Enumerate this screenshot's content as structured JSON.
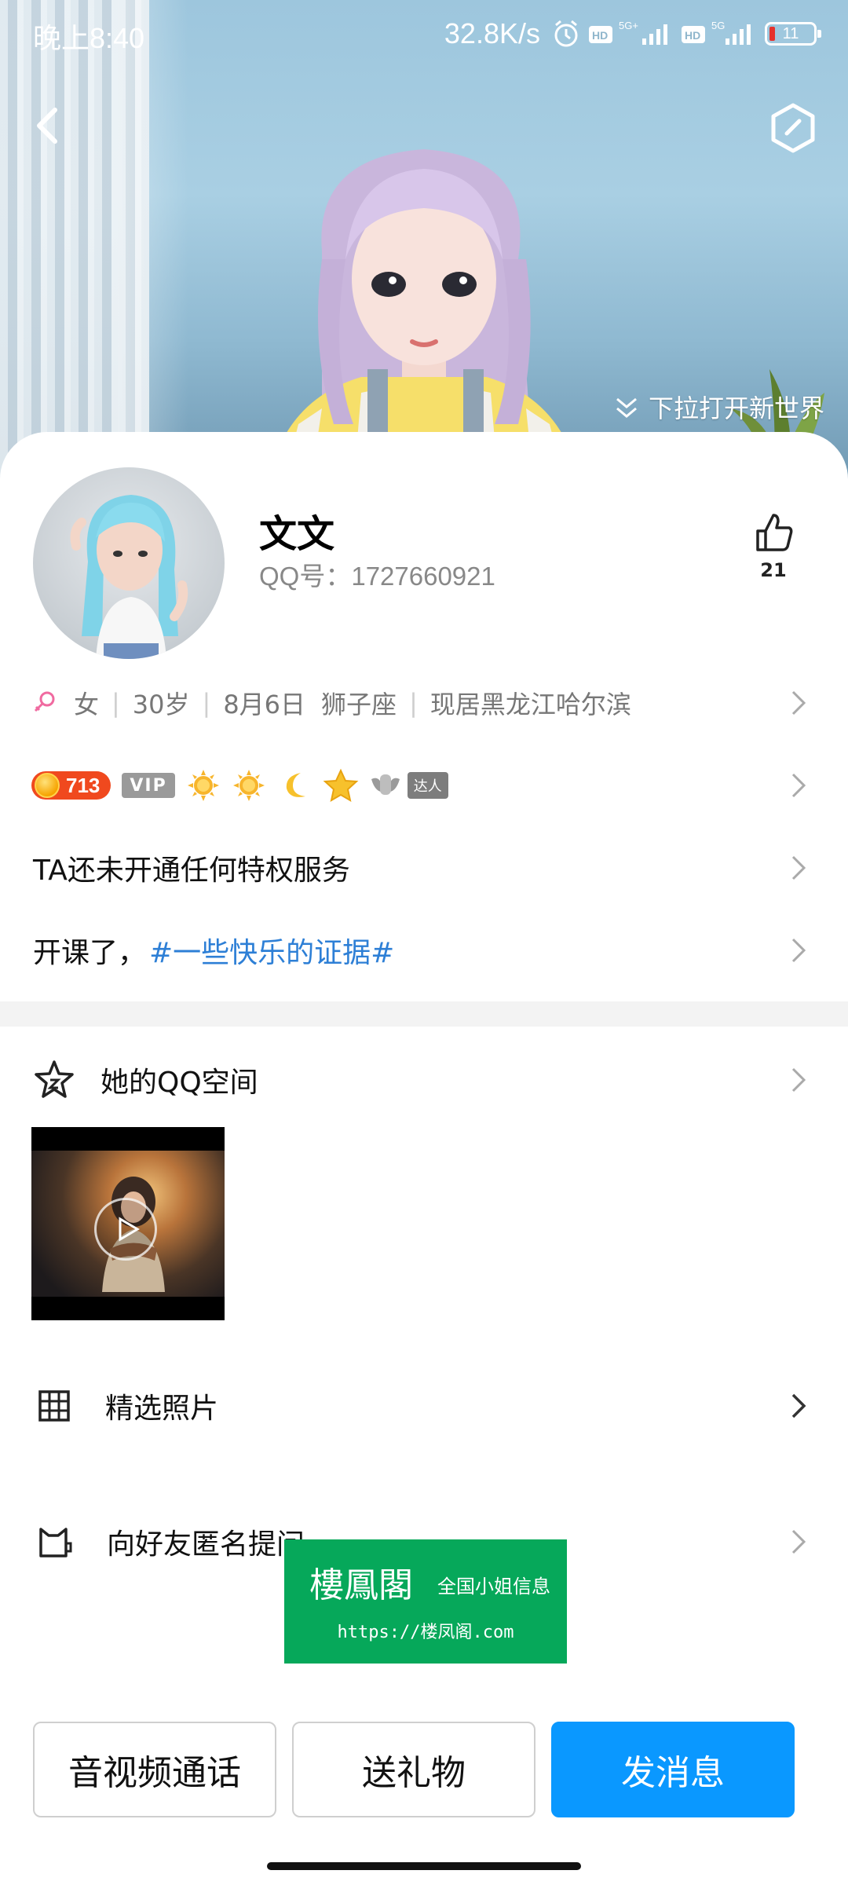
{
  "status_bar": {
    "time": "晚上8:40",
    "net_speed": "32.8K/s",
    "battery": "11"
  },
  "cover": {
    "pull_hint": "下拉打开新世界"
  },
  "profile": {
    "name": "文文",
    "qq_label": "QQ号：1727660921",
    "likes": "21",
    "gender": "女",
    "age": "30岁",
    "birthday": "8月6日",
    "zodiac": "狮子座",
    "location": "现居黑龙江哈尔滨"
  },
  "badges": {
    "level": "713",
    "vip": "VIP",
    "daren": "达人"
  },
  "privilege_text": "TA还未开通任何特权服务",
  "signature": {
    "text": "开课了，",
    "tag": "#一些快乐的证据#"
  },
  "qzone": {
    "title": "她的QQ空间"
  },
  "photos": {
    "title": "精选照片"
  },
  "anon_ask": {
    "title": "向好友匿名提问"
  },
  "watermark": {
    "title": "樓鳳閣",
    "subtitle": "全国小姐信息",
    "url": "https://楼凤阁.com"
  },
  "actions": {
    "call": "音视频通话",
    "gift": "送礼物",
    "message": "发消息"
  },
  "colors": {
    "accent_blue": "#0a98ff",
    "tag_blue": "#2d7fd6",
    "level_red": "#f0491e",
    "watermark_green": "#06a85a"
  }
}
